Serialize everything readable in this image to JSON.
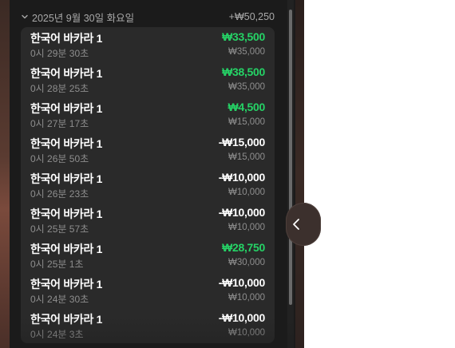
{
  "date_group": {
    "date_label": "2025년 9월 30일 화요일",
    "total": "+₩50,250"
  },
  "rows": [
    {
      "title": "한국어 바카라 1",
      "time": "0시 29분 30초",
      "amount": "₩33,500",
      "bet": "₩35,000",
      "type": "pos"
    },
    {
      "title": "한국어 바카라 1",
      "time": "0시 28분 25초",
      "amount": "₩38,500",
      "bet": "₩35,000",
      "type": "pos"
    },
    {
      "title": "한국어 바카라 1",
      "time": "0시 27분 17초",
      "amount": "₩4,500",
      "bet": "₩15,000",
      "type": "pos"
    },
    {
      "title": "한국어 바카라 1",
      "time": "0시 26분 50초",
      "amount": "-₩15,000",
      "bet": "₩15,000",
      "type": "neg"
    },
    {
      "title": "한국어 바카라 1",
      "time": "0시 26분 23초",
      "amount": "-₩10,000",
      "bet": "₩10,000",
      "type": "neg"
    },
    {
      "title": "한국어 바카라 1",
      "time": "0시 25분 57초",
      "amount": "-₩10,000",
      "bet": "₩10,000",
      "type": "neg"
    },
    {
      "title": "한국어 바카라 1",
      "time": "0시 25분 1초",
      "amount": "₩28,750",
      "bet": "₩30,000",
      "type": "pos"
    },
    {
      "title": "한국어 바카라 1",
      "time": "0시 24분 30초",
      "amount": "-₩10,000",
      "bet": "₩10,000",
      "type": "neg"
    },
    {
      "title": "한국어 바카라 1",
      "time": "0시 24분 3초",
      "amount": "-₩10,000",
      "bet": "₩10,000",
      "type": "neg"
    }
  ],
  "colors": {
    "positive": "#25d366",
    "negative": "#ffffff",
    "panel_bg": "#1b1b1b",
    "card_bg": "#2a2a2a"
  },
  "icons": {
    "collapse": "chevron-left-icon",
    "group_toggle": "chevron-down-icon"
  }
}
